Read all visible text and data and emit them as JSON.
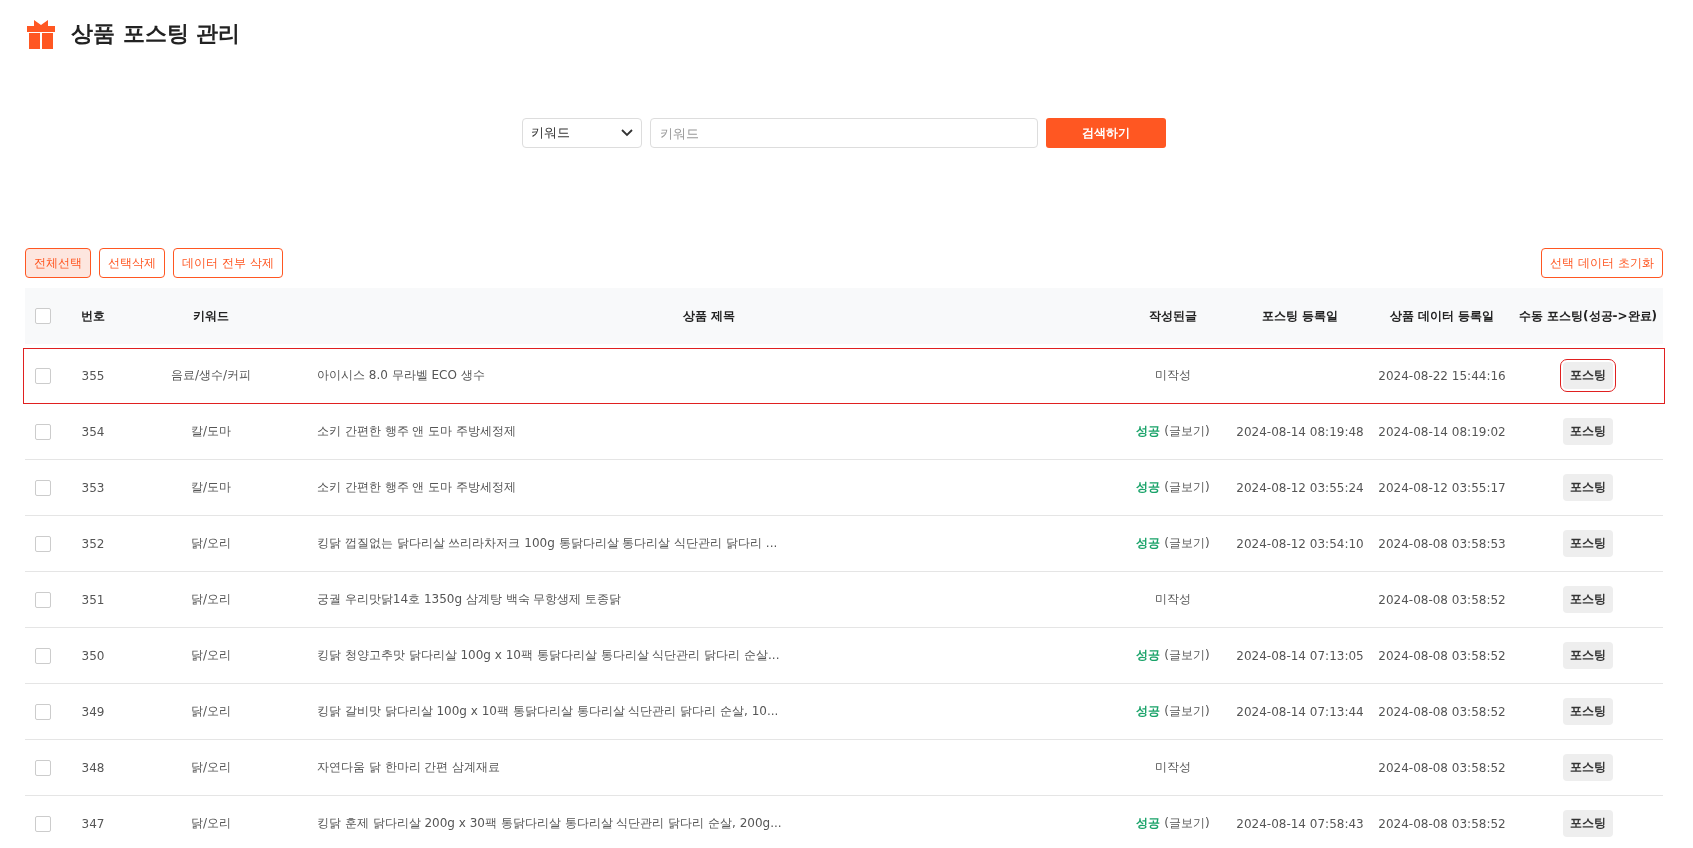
{
  "page": {
    "title": "상품 포스팅 관리"
  },
  "search": {
    "select_value": "키워드",
    "placeholder": "키워드",
    "button": "검색하기"
  },
  "actions": [
    {
      "label": "전체선택",
      "selected": true
    },
    {
      "label": "선택삭제",
      "selected": false
    },
    {
      "label": "데이터 전부 삭제",
      "selected": false
    }
  ],
  "reset_button": "선택 데이터 초기화",
  "table": {
    "select_all_checked": false,
    "columns": [
      "번호",
      "키워드",
      "상품 제목",
      "작성된글",
      "포스팅 등록일",
      "상품 데이터 등록일",
      "수동 포스팅(성공->완료)"
    ],
    "rows": [
      {
        "selected": true,
        "checked": false,
        "number": "355",
        "keyword": "음료/생수/커피",
        "title": "아이시스 8.0 무라벨 ECO 생수",
        "status": {
          "kind": "draft",
          "label": "미작성"
        },
        "posted_at": "",
        "data_at": "2024-08-22 15:44:16",
        "action": "포스팅"
      },
      {
        "selected": false,
        "checked": false,
        "number": "354",
        "keyword": "칼/도마",
        "title": "소키 간편한 행주 앤 도마 주방세정제",
        "status": {
          "kind": "success",
          "label": "성공",
          "link": "(글보기)"
        },
        "posted_at": "2024-08-14 08:19:48",
        "data_at": "2024-08-14 08:19:02",
        "action": "포스팅"
      },
      {
        "selected": false,
        "checked": false,
        "number": "353",
        "keyword": "칼/도마",
        "title": "소키 간편한 행주 앤 도마 주방세정제",
        "status": {
          "kind": "success",
          "label": "성공",
          "link": "(글보기)"
        },
        "posted_at": "2024-08-12 03:55:24",
        "data_at": "2024-08-12 03:55:17",
        "action": "포스팅"
      },
      {
        "selected": false,
        "checked": false,
        "number": "352",
        "keyword": "닭/오리",
        "title": "킹닭 껍질없는 닭다리살 쓰리라차저크 100g 통닭다리살 통다리살 식단관리 닭다리 ...",
        "status": {
          "kind": "success",
          "label": "성공",
          "link": "(글보기)"
        },
        "posted_at": "2024-08-12 03:54:10",
        "data_at": "2024-08-08 03:58:53",
        "action": "포스팅"
      },
      {
        "selected": false,
        "checked": false,
        "number": "351",
        "keyword": "닭/오리",
        "title": "궁궐 우리맛닭14호 1350g 삼계탕 백숙 무항생제 토종닭",
        "status": {
          "kind": "draft",
          "label": "미작성"
        },
        "posted_at": "",
        "data_at": "2024-08-08 03:58:52",
        "action": "포스팅"
      },
      {
        "selected": false,
        "checked": false,
        "number": "350",
        "keyword": "닭/오리",
        "title": "킹닭 청양고추맛 닭다리살 100g x 10팩 통닭다리살 통다리살 식단관리 닭다리 순살...",
        "status": {
          "kind": "success",
          "label": "성공",
          "link": "(글보기)"
        },
        "posted_at": "2024-08-14 07:13:05",
        "data_at": "2024-08-08 03:58:52",
        "action": "포스팅"
      },
      {
        "selected": false,
        "checked": false,
        "number": "349",
        "keyword": "닭/오리",
        "title": "킹닭 갈비맛 닭다리살 100g x 10팩 통닭다리살 통다리살 식단관리 닭다리 순살, 10...",
        "status": {
          "kind": "success",
          "label": "성공",
          "link": "(글보기)"
        },
        "posted_at": "2024-08-14 07:13:44",
        "data_at": "2024-08-08 03:58:52",
        "action": "포스팅"
      },
      {
        "selected": false,
        "checked": false,
        "number": "348",
        "keyword": "닭/오리",
        "title": "자연다움 닭 한마리 간편 삼계재료",
        "status": {
          "kind": "draft",
          "label": "미작성"
        },
        "posted_at": "",
        "data_at": "2024-08-08 03:58:52",
        "action": "포스팅"
      },
      {
        "selected": false,
        "checked": false,
        "number": "347",
        "keyword": "닭/오리",
        "title": "킹닭 훈제 닭다리살 200g x 30팩 통닭다리살 통다리살 식단관리 닭다리 순살, 200g...",
        "status": {
          "kind": "success",
          "label": "성공",
          "link": "(글보기)"
        },
        "posted_at": "2024-08-14 07:58:43",
        "data_at": "2024-08-08 03:58:52",
        "action": "포스팅"
      }
    ]
  }
}
